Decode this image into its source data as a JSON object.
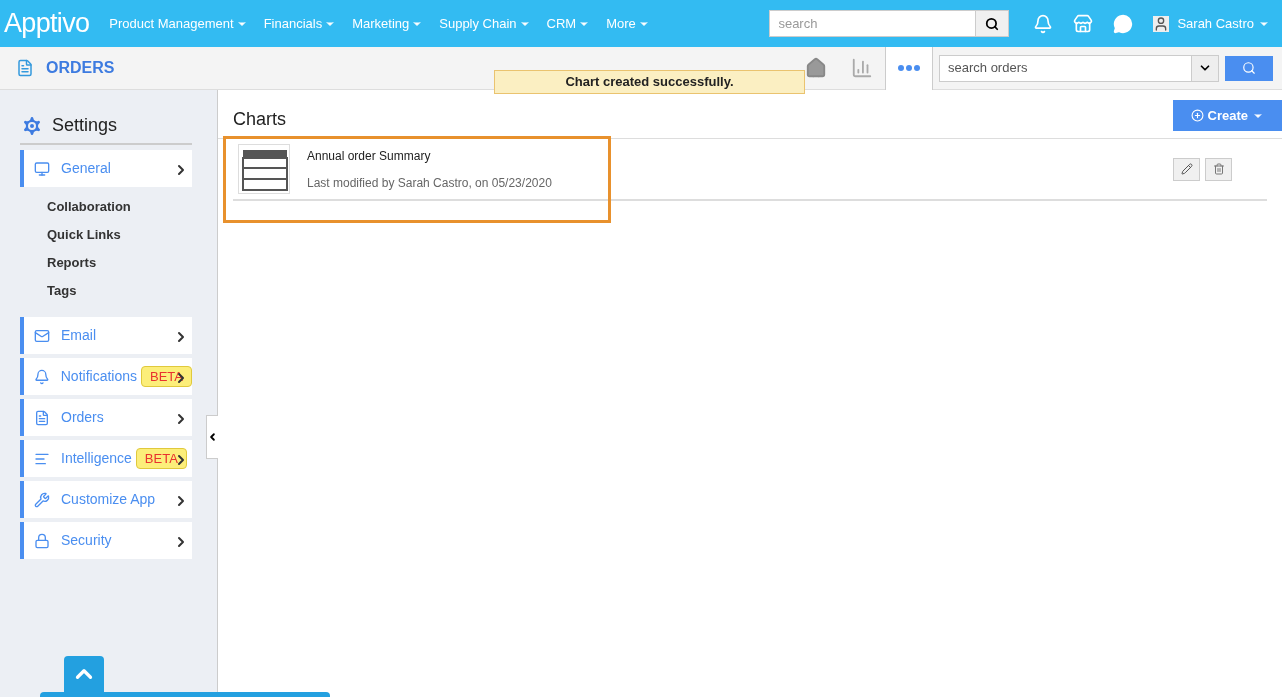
{
  "app": {
    "logo": "Apptivo",
    "menu": [
      {
        "label": "Product Management"
      },
      {
        "label": "Financials"
      },
      {
        "label": "Marketing"
      },
      {
        "label": "Supply Chain"
      },
      {
        "label": "CRM"
      },
      {
        "label": "More"
      }
    ],
    "search": {
      "placeholder": "search"
    },
    "user": "Sarah Castro"
  },
  "module": {
    "title": "ORDERS",
    "search": {
      "placeholder": "search orders"
    }
  },
  "toast": "Chart created successfully.",
  "sidebar": {
    "title": "Settings",
    "items": [
      {
        "label": "General",
        "children": [
          {
            "label": "Collaboration"
          },
          {
            "label": "Quick Links"
          },
          {
            "label": "Reports"
          },
          {
            "label": "Tags"
          }
        ]
      },
      {
        "label": "Email"
      },
      {
        "label": "Notifications",
        "badge": "BETA"
      },
      {
        "label": "Orders"
      },
      {
        "label": "Intelligence",
        "badge": "BETA"
      },
      {
        "label": "Customize App"
      },
      {
        "label": "Security"
      }
    ]
  },
  "main": {
    "title": "Charts",
    "create_button": "Create",
    "charts": [
      {
        "name": "Annual order Summary",
        "meta": "Last modified by Sarah Castro, on 05/23/2020",
        "highlighted": true
      }
    ]
  }
}
